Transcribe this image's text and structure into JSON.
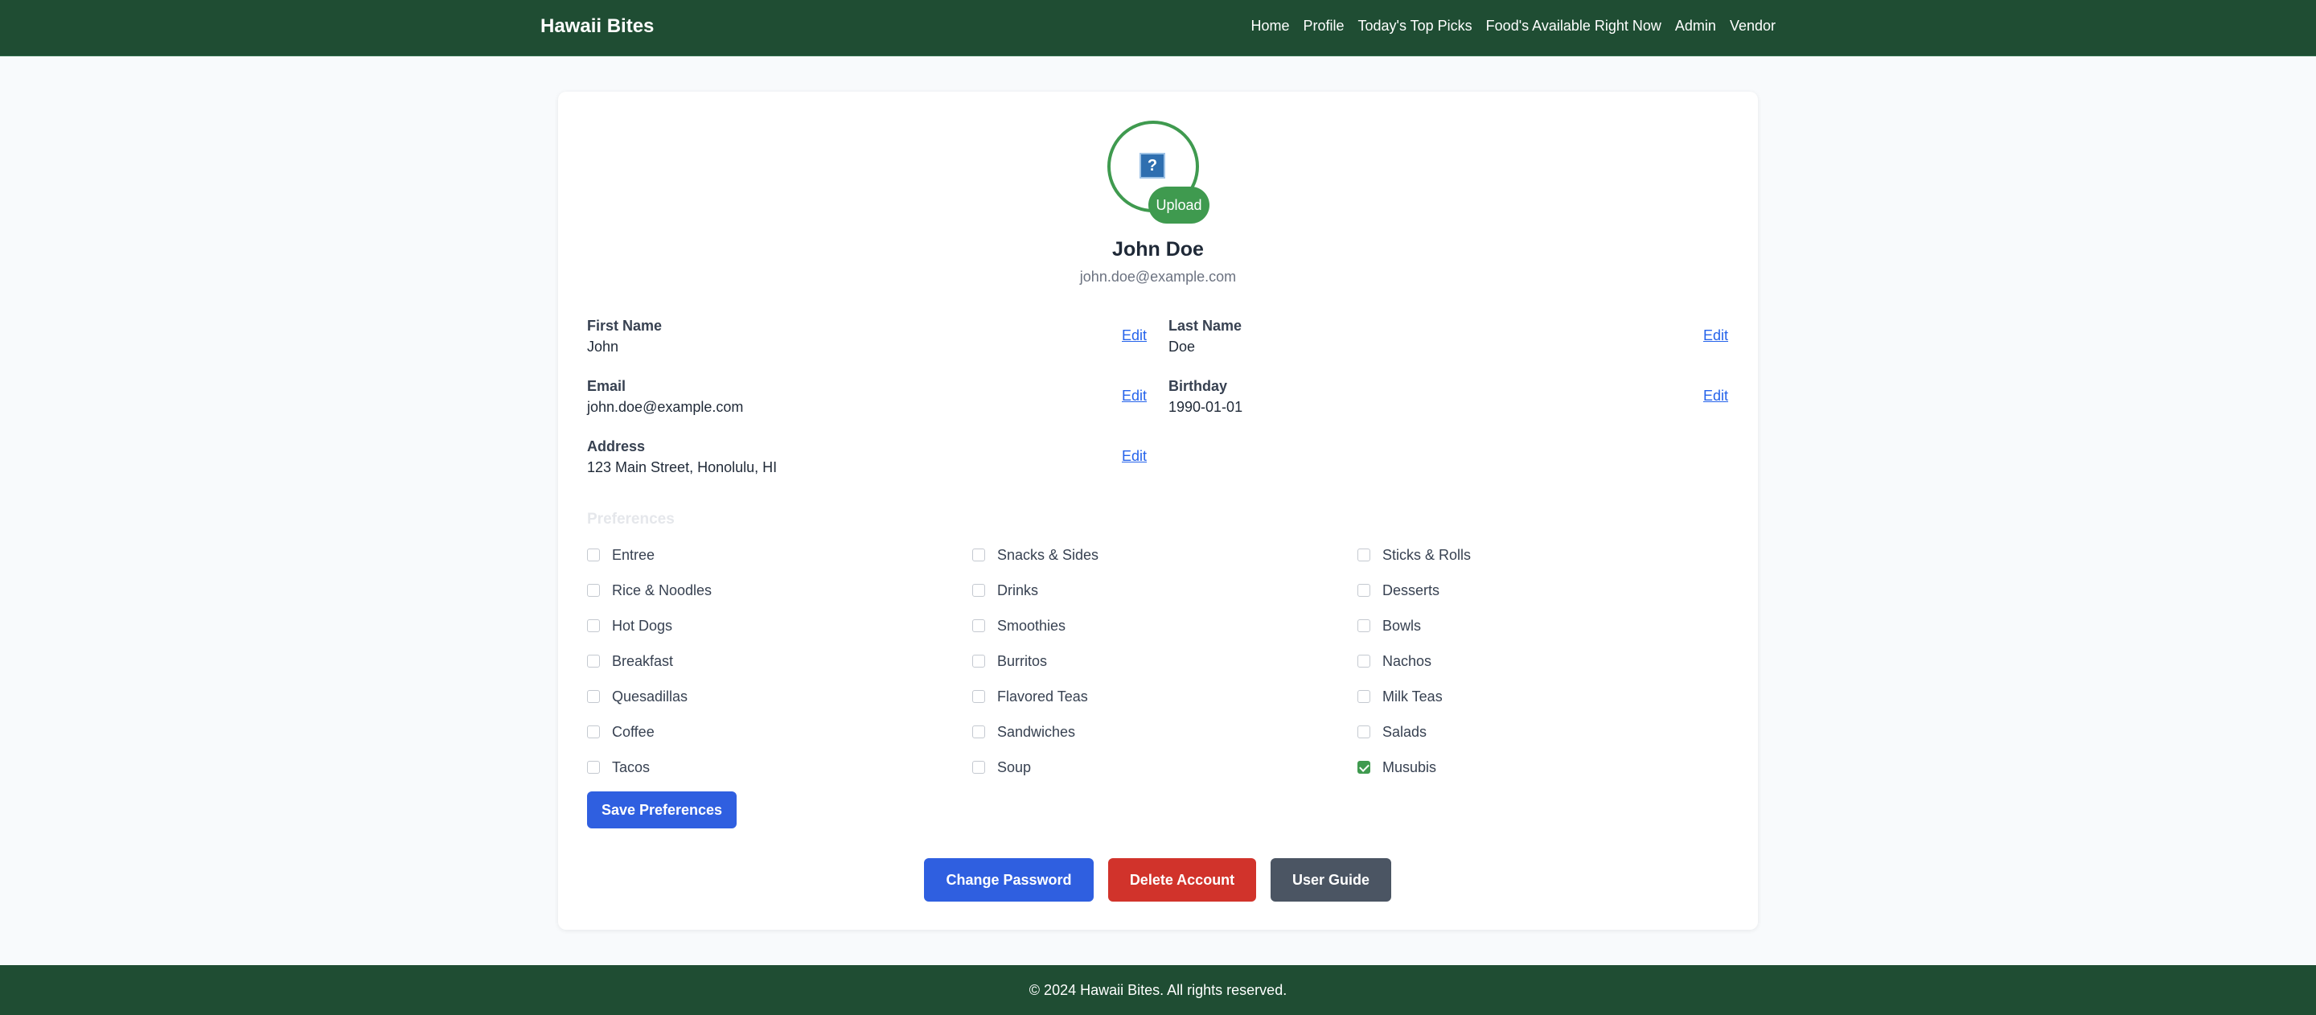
{
  "header": {
    "brand": "Hawaii Bites",
    "nav": [
      "Home",
      "Profile",
      "Today's Top Picks",
      "Food's Available Right Now",
      "Admin",
      "Vendor"
    ]
  },
  "profile": {
    "avatar_glyph": "?",
    "upload_label": "Upload",
    "name": "John Doe",
    "email": "john.doe@example.com",
    "edit_label": "Edit",
    "fields": {
      "first_name": {
        "label": "First Name",
        "value": "John"
      },
      "last_name": {
        "label": "Last Name",
        "value": "Doe"
      },
      "email": {
        "label": "Email",
        "value": "john.doe@example.com"
      },
      "birthday": {
        "label": "Birthday",
        "value": "1990-01-01"
      },
      "address": {
        "label": "Address",
        "value": "123 Main Street, Honolulu, HI"
      }
    }
  },
  "preferences": {
    "title": "Preferences",
    "columns": [
      [
        {
          "label": "Entree",
          "checked": false
        },
        {
          "label": "Rice & Noodles",
          "checked": false
        },
        {
          "label": "Hot Dogs",
          "checked": false
        },
        {
          "label": "Breakfast",
          "checked": false
        },
        {
          "label": "Quesadillas",
          "checked": false
        },
        {
          "label": "Coffee",
          "checked": false
        },
        {
          "label": "Tacos",
          "checked": false
        }
      ],
      [
        {
          "label": "Snacks & Sides",
          "checked": false
        },
        {
          "label": "Drinks",
          "checked": false
        },
        {
          "label": "Smoothies",
          "checked": false
        },
        {
          "label": "Burritos",
          "checked": false
        },
        {
          "label": "Flavored Teas",
          "checked": false
        },
        {
          "label": "Sandwiches",
          "checked": false
        },
        {
          "label": "Soup",
          "checked": false
        }
      ],
      [
        {
          "label": "Sticks & Rolls",
          "checked": false
        },
        {
          "label": "Desserts",
          "checked": false
        },
        {
          "label": "Bowls",
          "checked": false
        },
        {
          "label": "Nachos",
          "checked": false
        },
        {
          "label": "Milk Teas",
          "checked": false
        },
        {
          "label": "Salads",
          "checked": false
        },
        {
          "label": "Musubis",
          "checked": true
        }
      ]
    ],
    "save_label": "Save Preferences"
  },
  "actions": {
    "change_password": "Change Password",
    "delete_account": "Delete Account",
    "user_guide": "User Guide"
  },
  "footer": {
    "text": "© 2024 Hawaii Bites. All rights reserved."
  },
  "colors": {
    "header_bg": "#1f4d33",
    "accent_green": "#3f9a4f",
    "primary_blue": "#2f5fe0",
    "danger_red": "#d1332b",
    "neutral_gray": "#4b5563",
    "link_blue": "#2563eb"
  }
}
